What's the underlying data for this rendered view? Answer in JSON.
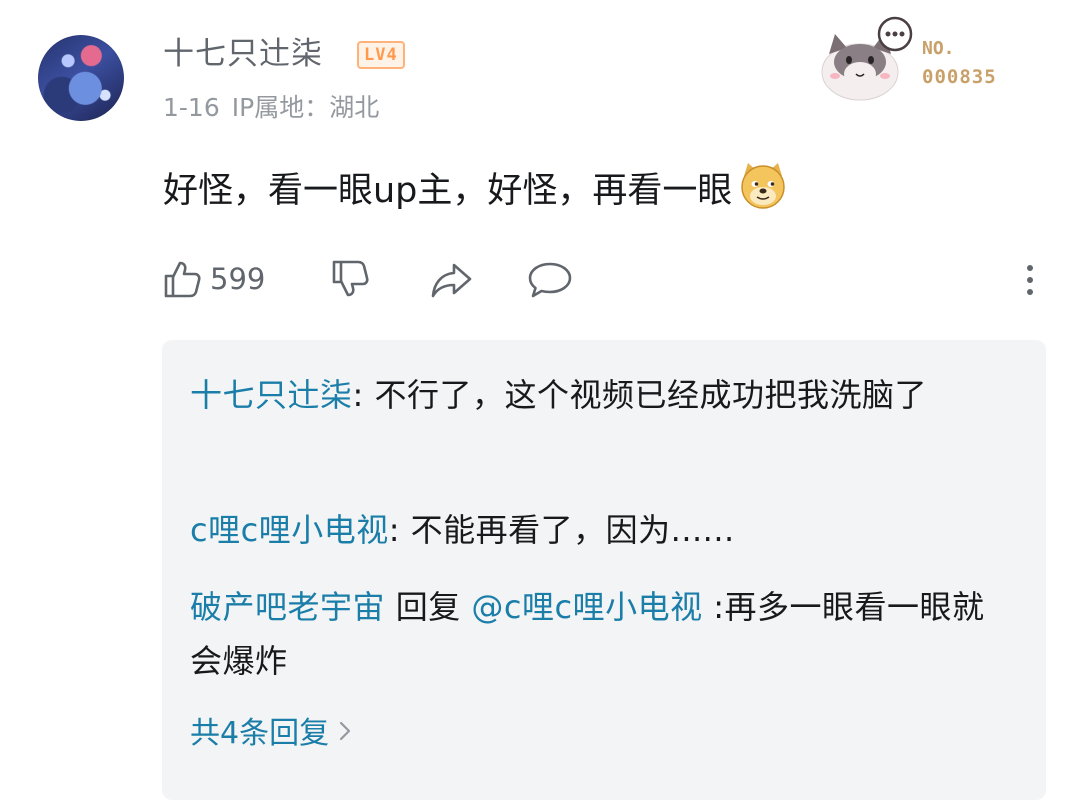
{
  "comment": {
    "username": "十七只辻柒",
    "level": "LV4",
    "date": "1-16",
    "ip_location": "IP属地：湖北",
    "text": "好怪，看一眼up主，好怪，再看一眼",
    "emoji_icon": "doge-emoji-icon",
    "like_count": "599"
  },
  "fan_badge": {
    "no_label": "NO.",
    "number": "000835"
  },
  "replies": [
    {
      "author": "十七只辻柒",
      "separator": ":",
      "text": " 不行了，这个视频已经成功把我洗脑了"
    },
    {
      "author": "c哩c哩小电视",
      "separator": ":",
      "text": " 不能再看了，因为......"
    },
    {
      "author": "破产吧老宇宙",
      "reply_word": " 回复 ",
      "mention": "@c哩c哩小电视",
      "text": " :再多一眼看一眼就会爆炸"
    }
  ],
  "more_replies_label": "共4条回复",
  "colors": {
    "link_blue": "#1a7ea8",
    "secondary_text": "#61666d",
    "meta_text": "#9499a0",
    "reply_bg": "#f3f4f6",
    "level_orange": "#ff9a4d"
  }
}
